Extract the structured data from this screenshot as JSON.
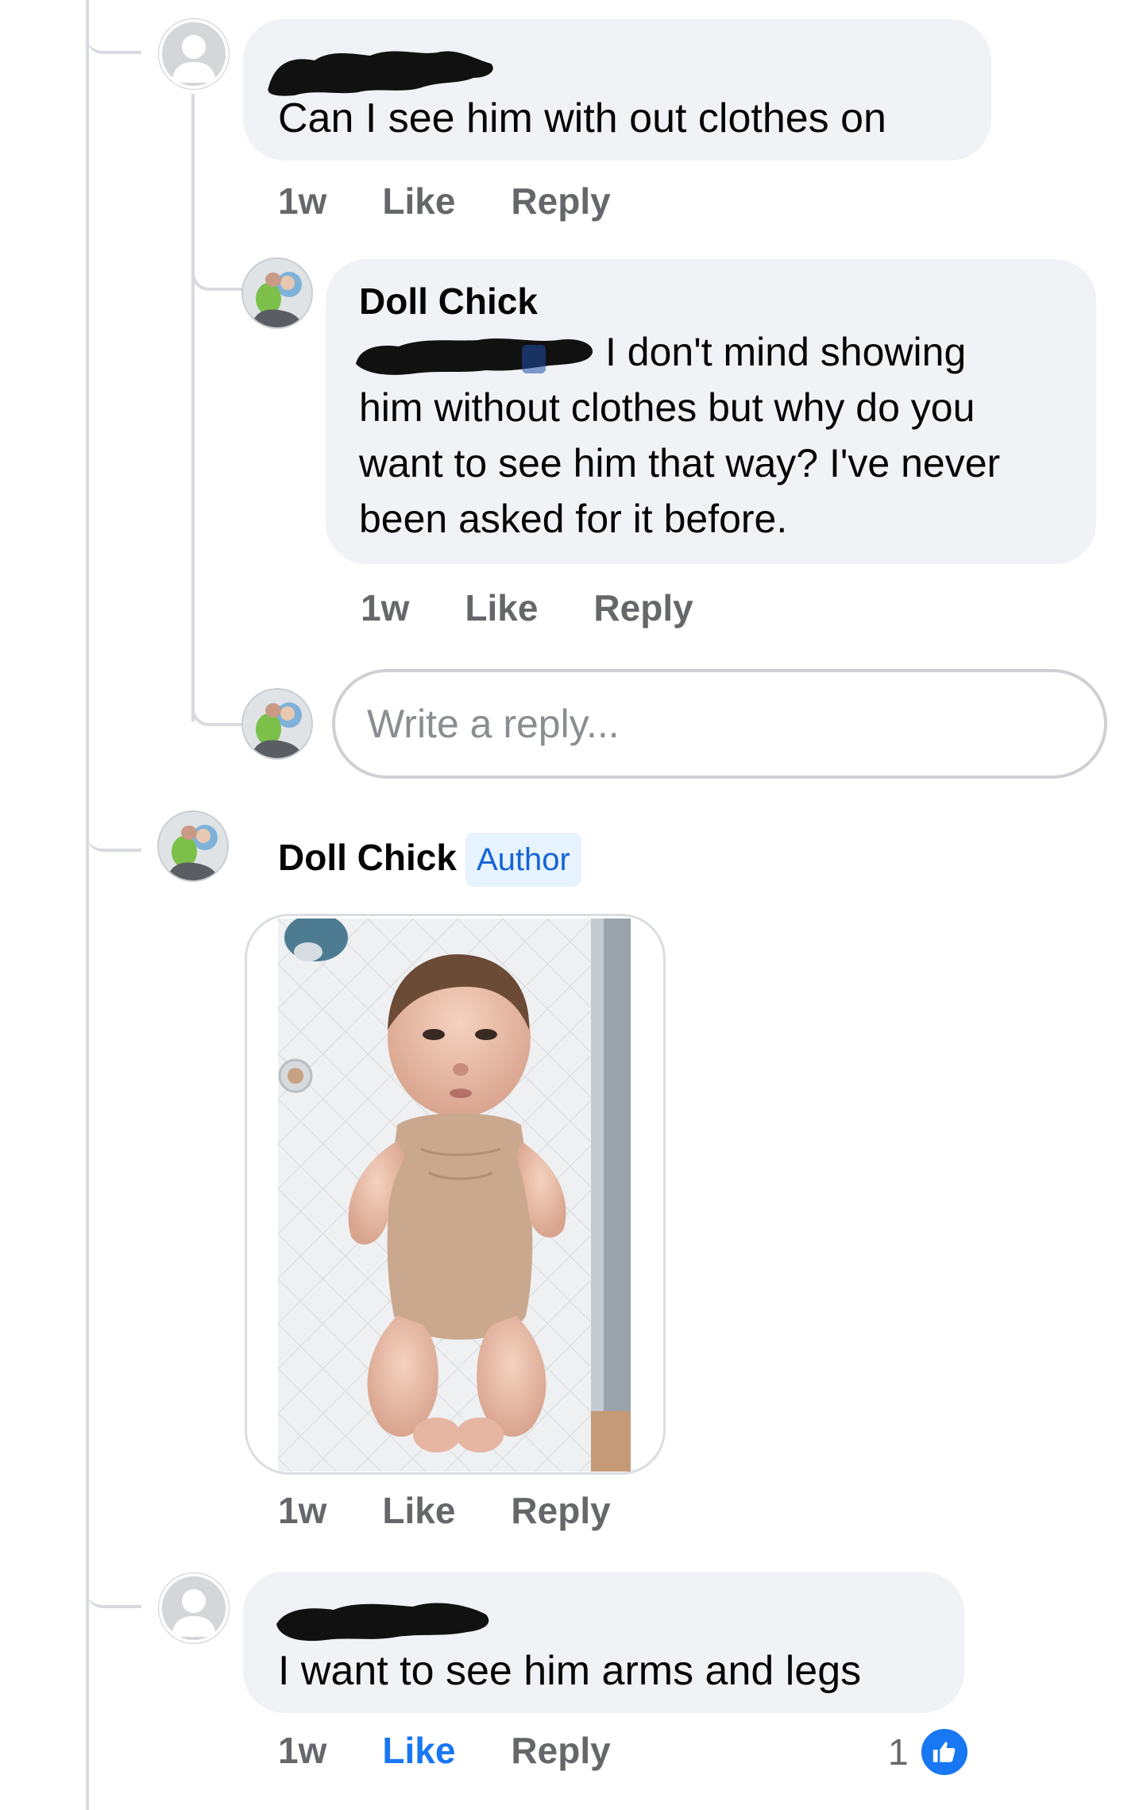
{
  "thread": [
    {
      "author": "",
      "author_redacted": true,
      "text": "Can I see him with out clothes on",
      "time": "1w",
      "like_label": "Like",
      "reply_label": "Reply"
    },
    {
      "author": "Doll Chick",
      "mention_redacted": true,
      "text_lines": [
        "I don't mind showing",
        "him without clothes but why do you",
        "want to see him that way? I've never",
        "been asked for it before."
      ],
      "time": "1w",
      "like_label": "Like",
      "reply_label": "Reply"
    },
    {
      "reply_placeholder": "Write a reply..."
    },
    {
      "author": "Doll Chick",
      "badge": "Author",
      "attachment": "photo",
      "time": "1w",
      "like_label": "Like",
      "reply_label": "Reply"
    },
    {
      "author": "",
      "author_redacted": true,
      "text": "I want to see him arms and legs",
      "time": "1w",
      "like_label": "Like",
      "like_active": true,
      "reply_label": "Reply",
      "reaction_count": "1",
      "reaction_icon": "thumbs-up-icon"
    }
  ],
  "colors": {
    "bubble": "#f0f2f5",
    "action_text": "#65676b",
    "link_blue": "#1877f2",
    "badge_bg": "#e7f3ff",
    "badge_text": "#1464d6"
  }
}
